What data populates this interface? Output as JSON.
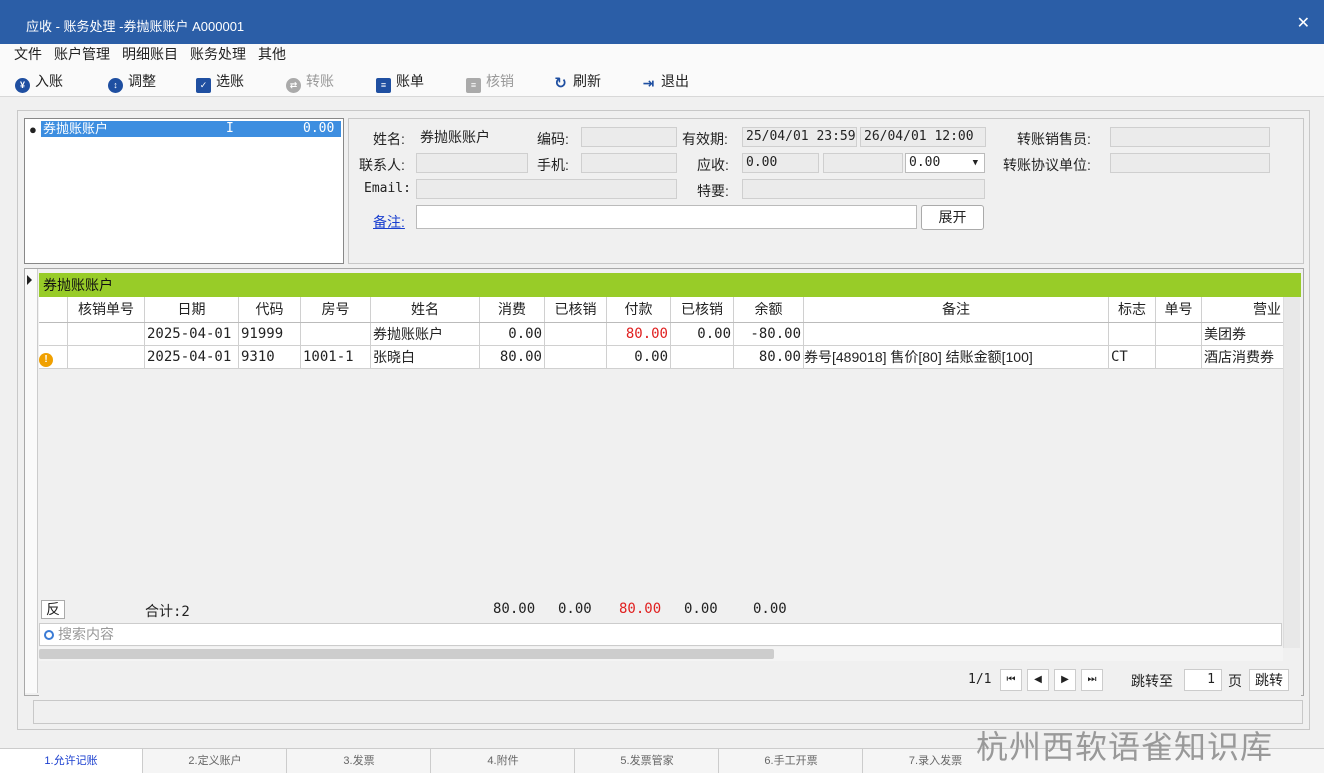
{
  "window": {
    "title": "应收 - 账务处理 -券抛账账户  A000001",
    "close": "✕"
  },
  "menu": [
    "文件",
    "账户管理",
    "明细账目",
    "账务处理",
    "其他"
  ],
  "toolbar": {
    "enter": "入账",
    "adjust": "调整",
    "select": "选账",
    "transfer": "转账",
    "bill": "账单",
    "writeoff": "核销",
    "refresh": "刷新",
    "exit": "退出"
  },
  "account_list": {
    "selected": {
      "name": "券抛账账户",
      "flag": "I",
      "amount": "0.00"
    }
  },
  "info": {
    "name_label": "姓名:",
    "name_value": "券抛账账户",
    "code_label": "编码:",
    "code_value": "",
    "valid_label": "有效期:",
    "valid_from": "25/04/01 23:59",
    "valid_to": "26/04/01 12:00",
    "transfer_seller_label": "转账销售员:",
    "transfer_seller_value": "",
    "contact_label": "联系人:",
    "contact_value": "",
    "mobile_label": "手机:",
    "mobile_value": "",
    "receivable_label": "应收:",
    "receivable_value": "0.00",
    "receivable_extra": "",
    "receivable_select": "0.00",
    "transfer_unit_label": "转账协议单位:",
    "transfer_unit_value": "",
    "email_label": "Email:",
    "email_value": "",
    "special_label": "特要:",
    "special_value": "",
    "remark_label": "备注:",
    "remark_value": "",
    "expand_button": "展开"
  },
  "grid": {
    "title": "券抛账账户",
    "columns": [
      "",
      "核销单号",
      "日期",
      "代码",
      "房号",
      "姓名",
      "消费",
      "已核销",
      "付款",
      "已核销",
      "余额",
      "备注",
      "标志",
      "单号",
      "营业"
    ],
    "rows": [
      {
        "warn": "",
        "writeoff_no": "",
        "date": "2025-04-01",
        "code": "91999",
        "room": "",
        "name": "券抛账账户",
        "consume": "0.00",
        "consume_wo": "",
        "pay": "80.00",
        "pay_wo": "0.00",
        "balance": "-80.00",
        "remark": "",
        "flag": "",
        "no": "",
        "biz": "美团券"
      },
      {
        "warn": "!",
        "writeoff_no": "",
        "date": "2025-04-01",
        "code": "9310",
        "room": "1001-1",
        "name": "张晓白",
        "consume": "80.00",
        "consume_wo": "",
        "pay": "0.00",
        "pay_wo": "",
        "balance": "80.00",
        "remark": "券号[489018] 售价[80] 结账金额[100]",
        "flag": "CT",
        "no": "",
        "biz": "酒店消费券"
      }
    ],
    "totals": {
      "reverse": "反",
      "count": "合计:2",
      "consume": "80.00",
      "consume_wo": "0.00",
      "pay": "80.00",
      "pay_wo": "0.00",
      "balance": "0.00"
    },
    "search_placeholder": "搜索内容"
  },
  "pager": {
    "page_info": "1/1",
    "jump_label": "跳转至",
    "page_input": "1",
    "page_unit": "页",
    "jump_button": "跳转"
  },
  "tabs": [
    "1.允许记账",
    "2.定义账户",
    "3.发票",
    "4.附件",
    "5.发票管家",
    "6.手工开票",
    "7.录入发票"
  ],
  "watermark": "杭州西软语雀知识库",
  "colors": {
    "titlebar": "#2b5ea7",
    "grid_header": "#98cc28",
    "selection": "#3d8ee0",
    "negative": "#e02020",
    "link": "#1a3fcf"
  }
}
